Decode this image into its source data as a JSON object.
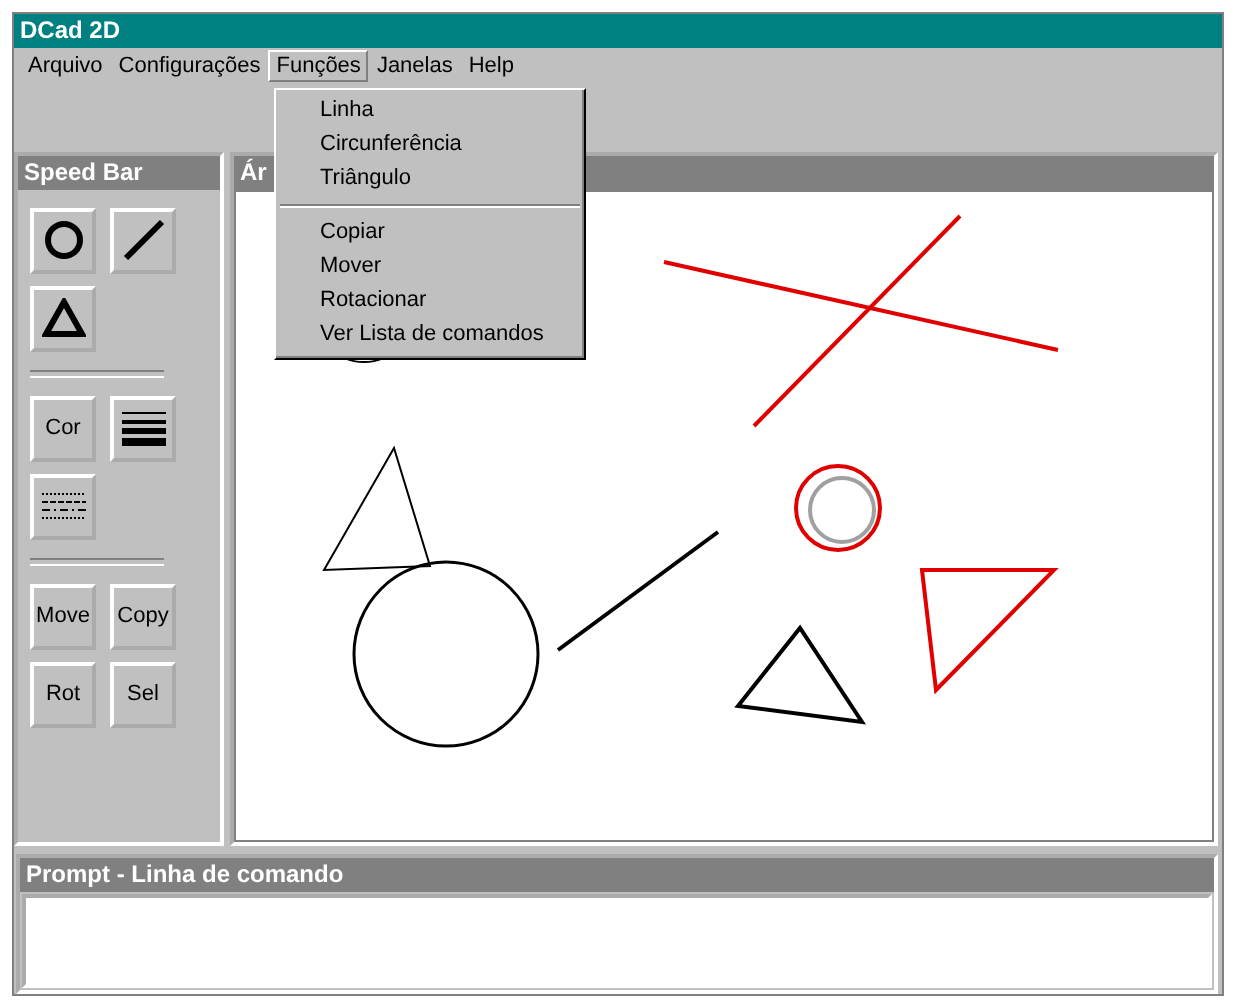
{
  "window": {
    "title": "DCad 2D"
  },
  "menu": [
    {
      "label": "Arquivo",
      "selected": false
    },
    {
      "label": "Configurações",
      "selected": false
    },
    {
      "label": "Funções",
      "selected": true
    },
    {
      "label": "Janelas",
      "selected": false
    },
    {
      "label": "Help",
      "selected": false
    }
  ],
  "open_menu": {
    "items": [
      {
        "kind": "item",
        "label": "Linha"
      },
      {
        "kind": "item",
        "label": "Circunferência"
      },
      {
        "kind": "item",
        "label": "Triângulo"
      },
      {
        "kind": "separator"
      },
      {
        "kind": "item",
        "label": "Copiar"
      },
      {
        "kind": "item",
        "label": "Mover"
      },
      {
        "kind": "item",
        "label": "Rotacionar"
      },
      {
        "kind": "item",
        "label": "Ver Lista de comandos"
      }
    ]
  },
  "speed_bar": {
    "title": "Speed Bar",
    "groups": [
      [
        {
          "kind": "circle"
        },
        {
          "kind": "line"
        },
        {
          "kind": "triangle"
        }
      ],
      [
        {
          "kind": "text",
          "label": "Cor"
        },
        {
          "kind": "line-width"
        },
        {
          "kind": "line-style"
        }
      ],
      [
        {
          "kind": "text",
          "label": "Move"
        },
        {
          "kind": "text",
          "label": "Copy"
        },
        {
          "kind": "text",
          "label": "Rot"
        },
        {
          "kind": "text",
          "label": "Sel"
        }
      ]
    ]
  },
  "canvas": {
    "title": "Ár"
  },
  "prompt": {
    "title": "Prompt - Linha de comando"
  }
}
